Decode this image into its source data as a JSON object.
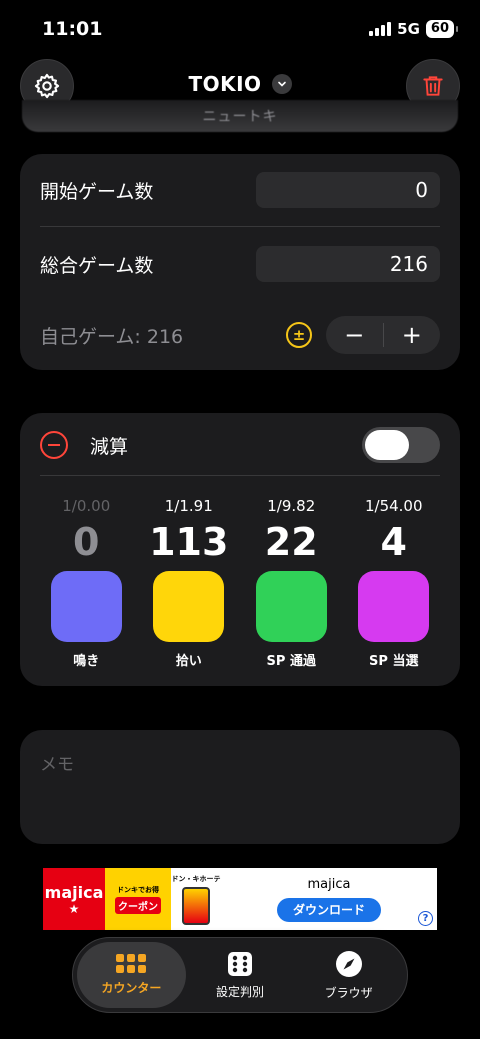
{
  "status": {
    "time": "11:01",
    "network": "5G",
    "battery": "60"
  },
  "header": {
    "title": "TOKIO",
    "subtitle": "ニュートキ"
  },
  "games": {
    "start_label": "開始ゲーム数",
    "start_value": "0",
    "total_label": "総合ゲーム数",
    "total_value": "216",
    "self_label": "自己ゲーム: 216",
    "plus_minus_symbol": "±",
    "decrement": "−",
    "increment": "+"
  },
  "counter_card": {
    "mode_label": "減算",
    "toggle_on": false,
    "counters": [
      {
        "ratio": "1/0.00",
        "count": "0",
        "label": "鳴き",
        "color": "#6e6cf7",
        "dim": true
      },
      {
        "ratio": "1/1.91",
        "count": "113",
        "label": "拾い",
        "color": "#ffd60a",
        "dim": false
      },
      {
        "ratio": "1/9.82",
        "count": "22",
        "label": "SP 通過",
        "color": "#30d158",
        "dim": false
      },
      {
        "ratio": "1/54.00",
        "count": "4",
        "label": "SP 当選",
        "color": "#d63af0",
        "dim": false
      }
    ]
  },
  "memo": {
    "placeholder": "メモ"
  },
  "ad": {
    "logo_text": "majica",
    "coupon_text": "クーポン",
    "banner_small": "ドンキでお得",
    "store_text": "ドン・キホーテ",
    "title": "majica",
    "button": "ダウンロード",
    "info": "?"
  },
  "tabs": [
    {
      "label": "カウンター",
      "icon": "grid-icon",
      "active": true
    },
    {
      "label": "設定判別",
      "icon": "dice-icon",
      "active": false
    },
    {
      "label": "ブラウザ",
      "icon": "compass-icon",
      "active": false
    }
  ],
  "colors": {
    "accent": "#f5a623",
    "danger": "#ff453a",
    "card": "#1c1c1e"
  }
}
